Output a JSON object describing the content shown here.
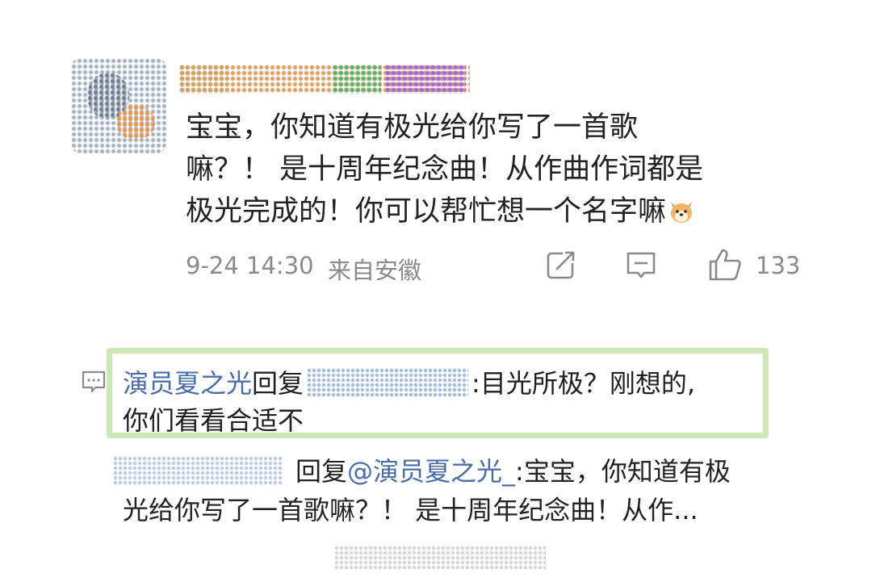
{
  "comment": {
    "text_line1": "宝宝，你知道有极光给你写了一首歌",
    "text_line2": "嘛？！ 是十周年纪念曲！从作曲作词都是",
    "text_line3": "极光完成的！你可以帮忙想一个名字嘛",
    "date": "9-24 14:30",
    "location": "来自安徽",
    "like_count": "133"
  },
  "reply": {
    "author": "演员夏之光",
    "reply_word": "回复",
    "text_part1": ":目光所极？刚想的,",
    "text_line2": "你们看看合适不"
  },
  "sub_reply": {
    "reply_word": "回复",
    "mention": "@演员夏之光_",
    "text_line1_rest": ":宝宝，你知道有极",
    "text_line2": "光给你写了一首歌嘛？！ 是十周年纪念曲！从作..."
  },
  "icons": {
    "share": "share-icon",
    "comment": "comment-icon",
    "like": "thumbs-up-icon",
    "reply": "reply-bubble-icon",
    "emoji": "dog-emoji-icon"
  },
  "colors": {
    "link_blue": "#4a6da7",
    "meta_gray": "#8a8a8a",
    "highlight_green": "#cde8b4"
  }
}
